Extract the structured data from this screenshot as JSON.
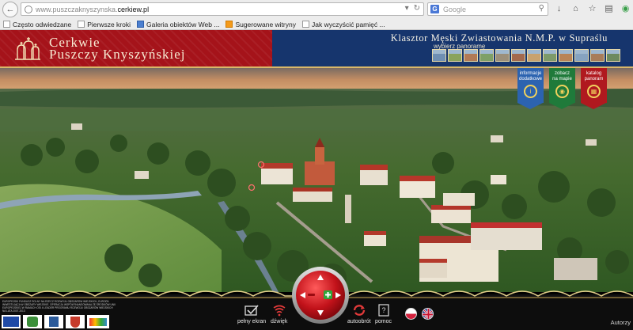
{
  "browser": {
    "url_prefix": "www.puszczaknyszynska.",
    "url_host": "cerkiew.pl",
    "search_engine": "G",
    "search_placeholder": "Google",
    "bookmarks": [
      {
        "label": "Często odwiedzane",
        "icon": "page-icon"
      },
      {
        "label": "Pierwsze kroki",
        "icon": "page-icon"
      },
      {
        "label": "Galeria obiektów Web ...",
        "icon": "page-icon"
      },
      {
        "label": "Sugerowane witryny",
        "icon": "orange-square-icon"
      },
      {
        "label": "Jak wyczyścić pamięć ...",
        "icon": "page-icon"
      }
    ]
  },
  "header": {
    "title_line1": "Cerkwie",
    "title_line2": "Puszczy Knyszyńskiej",
    "monastery": "Klasztor Męski Zwiastowania N.M.P. w Supraślu",
    "choose_panorama": "wybierz panoramę",
    "thumbnail_colors": [
      "#6f8fb3",
      "#8aa35c",
      "#b27a55",
      "#7ea067",
      "#9c8f7a",
      "#a36a4e",
      "#c8a26e",
      "#7d9a6a",
      "#b98457",
      "#86a3c0",
      "#a87d5a",
      "#6d8a5e"
    ]
  },
  "ribbons": {
    "info": {
      "label_line1": "informacje",
      "label_line2": "dodatkowe"
    },
    "map": {
      "label_line1": "zobacz",
      "label_line2": "na mapie"
    },
    "catalog": {
      "label_line1": "katalog",
      "label_line2": "panoram"
    }
  },
  "controls": {
    "fullscreen": "pełny ekran",
    "sound": "dźwięk",
    "autorotate": "autoobrót",
    "help": "pomoc",
    "authors": "Autorzy"
  },
  "eu_text": "EUROPEJSKI FUNDUSZ ROLNY NA RZECZ ROZWOJU OBSZARÓW WIEJSKICH. EUROPA INWESTUJĄCA W OBSZARY WIEJSKIE. OPERACJA WSPÓŁFINANSOWANA ZE ŚRODKÓW UNII EUROPEJSKIEJ W RAMACH OSI 4 LEADER PROGRAMU ROZWOJU OBSZARÓW WIEJSKICH NA LATA 2007-2013",
  "colors": {
    "header_red": "#a5131a",
    "header_blue": "#16356d",
    "gold": "#d9b869",
    "ribbon_blue": "#2c63b0",
    "ribbon_green": "#1f7a3a",
    "ribbon_red": "#b0191f"
  }
}
